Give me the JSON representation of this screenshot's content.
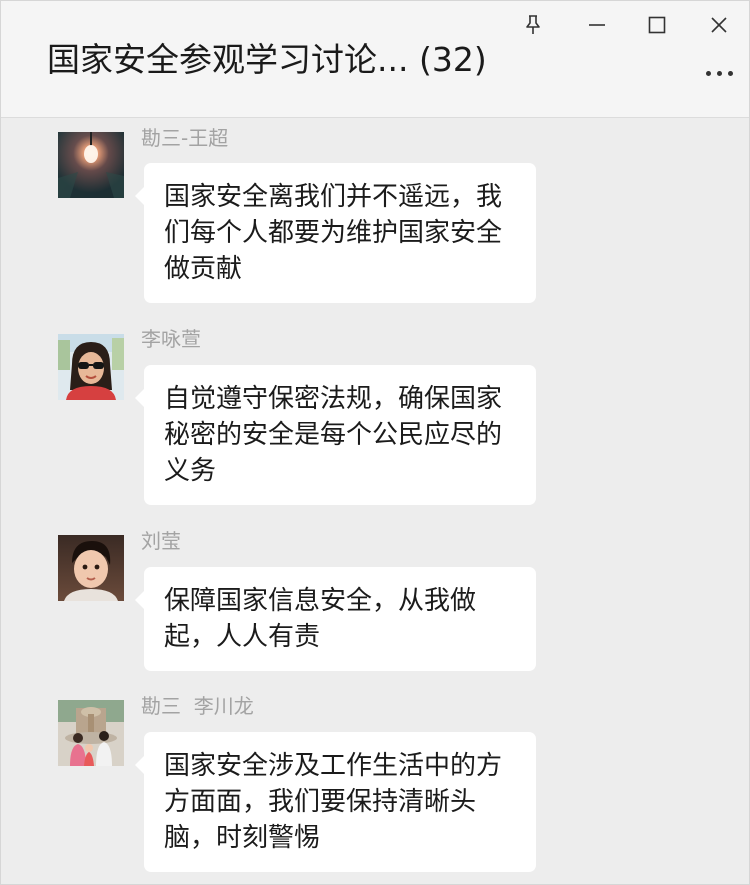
{
  "chat": {
    "title": "国家安全参观学习讨论...",
    "member_count": "(32)"
  },
  "window_controls": {
    "pin_icon": "pin-icon",
    "minimize_icon": "minimize-icon",
    "maximize_icon": "maximize-icon",
    "close_icon": "close-icon",
    "more_icon": "more-icon"
  },
  "messages": [
    {
      "sender": "勘三-王超",
      "text": "国家安全离我们并不遥远，我们每个人都要为维护国家安全做贡献",
      "avatar": "avatar-light-bulb"
    },
    {
      "sender": "李咏萱",
      "text": "自觉遵守保密法规，确保国家秘密的安全是每个公民应尽的义务",
      "avatar": "avatar-woman-sunglasses"
    },
    {
      "sender": "刘莹",
      "text": "保障国家信息安全，从我做起，人人有责",
      "avatar": "avatar-child-photo"
    },
    {
      "sender": "勘三  李川龙",
      "text": "国家安全涉及工作生活中的方方面面，我们要保持清晰头脑，时刻警惕",
      "avatar": "avatar-family-fountain"
    }
  ],
  "colors": {
    "background": "#ededed",
    "titlebar": "#f5f5f5",
    "bubble": "#ffffff",
    "sender_name": "#a3a3a3"
  }
}
